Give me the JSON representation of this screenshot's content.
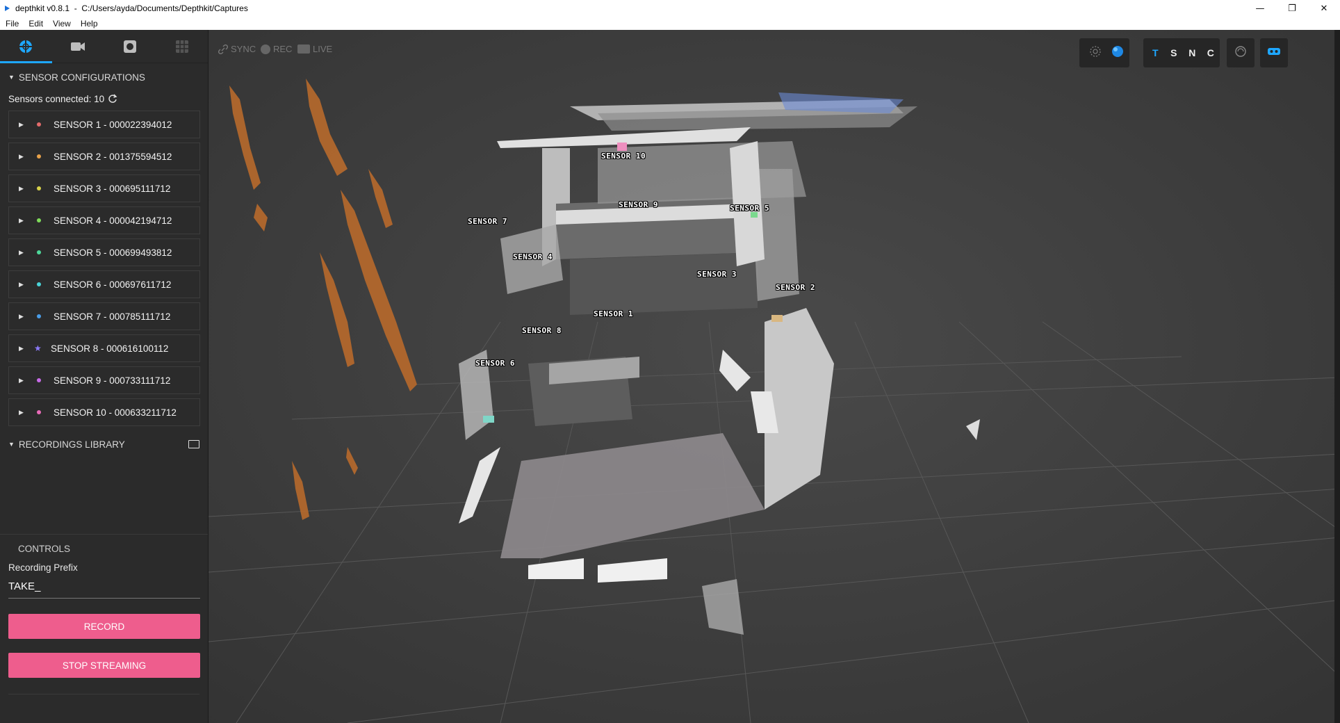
{
  "window": {
    "title": "depthkit v0.8.1  -  C:/Users/ayda/Documents/Depthkit/Captures",
    "minimize": "—",
    "restore": "❐",
    "close": "✕"
  },
  "menu": [
    "File",
    "Edit",
    "View",
    "Help"
  ],
  "sidebar": {
    "tabs": [
      {
        "icon": "sensor-config-icon"
      },
      {
        "icon": "video-camera-icon"
      },
      {
        "icon": "record-icon"
      },
      {
        "icon": "grid-icon"
      }
    ],
    "sensor_config_title": "SENSOR CONFIGURATIONS",
    "sensors_connected": "Sensors connected: 10",
    "sensors": [
      {
        "label": "SENSOR 1 - 000022394012",
        "color": "#e36b6b"
      },
      {
        "label": "SENSOR 2 - 001375594512",
        "color": "#e8a24a"
      },
      {
        "label": "SENSOR 3 - 000695111712",
        "color": "#d8d24a"
      },
      {
        "label": "SENSOR 4 - 000042194712",
        "color": "#7fdb5a"
      },
      {
        "label": "SENSOR 5 - 000699493812",
        "color": "#4ed89a"
      },
      {
        "label": "SENSOR 6 - 000697611712",
        "color": "#4ad4d8"
      },
      {
        "label": "SENSOR 7 - 000785111712",
        "color": "#4a9de8"
      },
      {
        "label": "SENSOR 8 - 000616100112",
        "color": "#8d7bff",
        "star": true
      },
      {
        "label": "SENSOR 9 - 000733111712",
        "color": "#c86be8"
      },
      {
        "label": "SENSOR 10 - 000633211712",
        "color": "#e86bb8"
      }
    ],
    "recordings_title": "RECORDINGS LIBRARY",
    "controls_title": "CONTROLS",
    "prefix_label": "Recording Prefix",
    "prefix_value": "TAKE_",
    "record_button": "RECORD",
    "stop_button": "STOP STREAMING"
  },
  "viewport": {
    "sync": "SYNC",
    "rec": "REC",
    "live": "LIVE",
    "view_letters": [
      "T",
      "S",
      "N",
      "C"
    ],
    "sensor_labels": [
      "SENSOR 10",
      "SENSOR 9",
      "SENSOR 5",
      "SENSOR 7",
      "SENSOR 4",
      "SENSOR 3",
      "SENSOR 2",
      "SENSOR 1",
      "SENSOR 8",
      "SENSOR 6"
    ]
  }
}
